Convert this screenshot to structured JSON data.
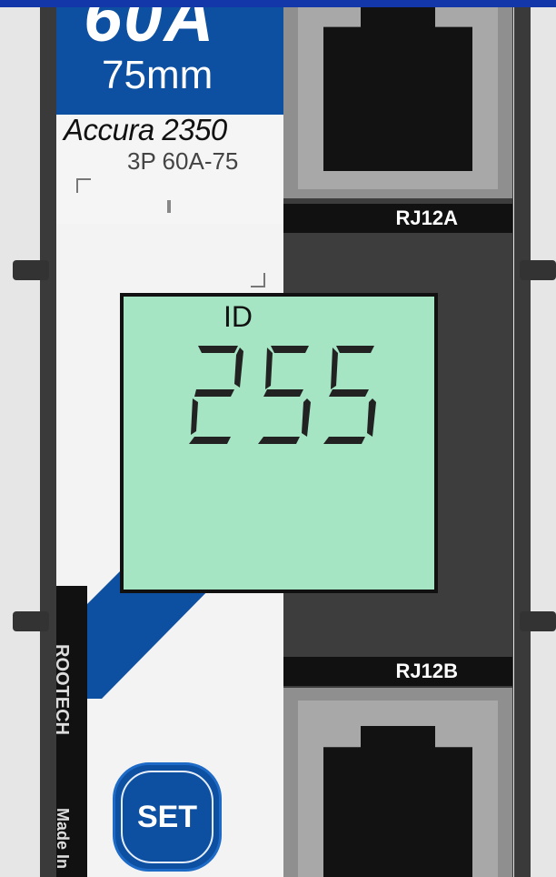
{
  "label": {
    "amperage": "60A",
    "diameter": "75mm",
    "brand": "Accura 2350",
    "model": "3P 60A-75"
  },
  "ports": {
    "top_label": "RJ12A",
    "bottom_label": "RJ12B"
  },
  "lcd": {
    "caption": "ID",
    "value": "255"
  },
  "side": {
    "manufacturer": "ROOTECH",
    "made_in": "Made In"
  },
  "controls": {
    "set_label": "SET"
  },
  "colors": {
    "accent_blue": "#0d4fa0",
    "lcd_green": "#a6e5c4"
  }
}
